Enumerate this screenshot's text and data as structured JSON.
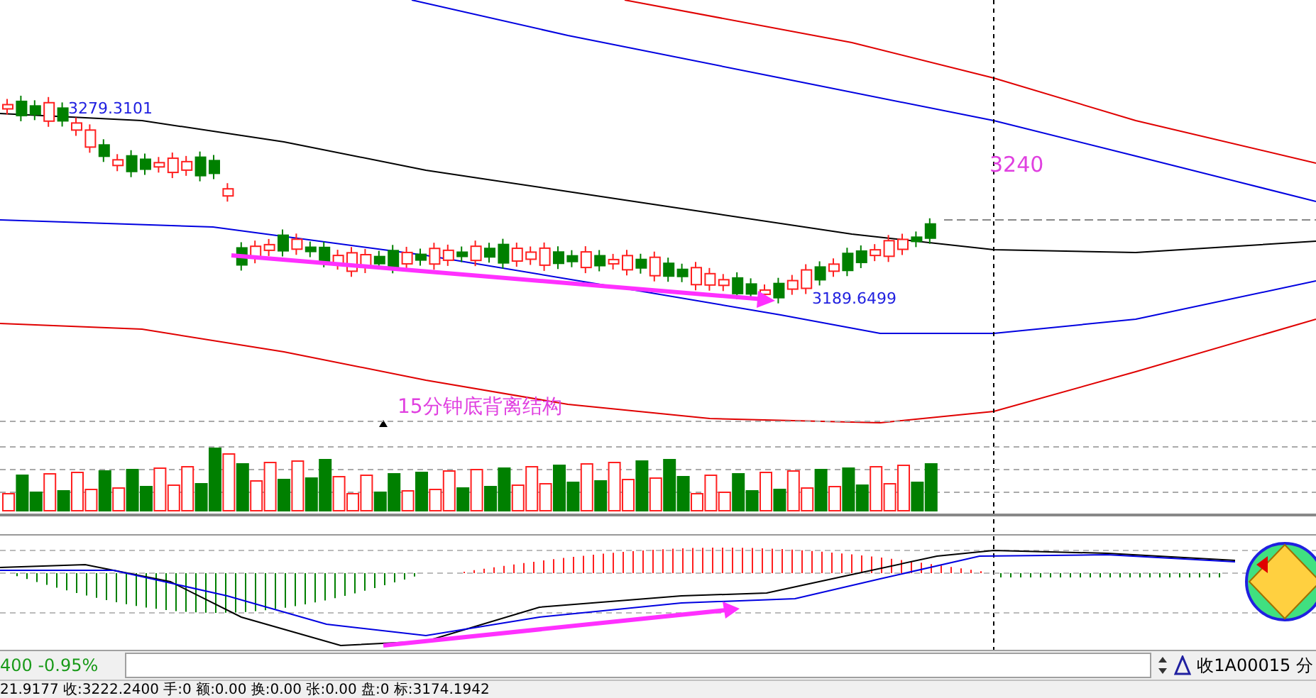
{
  "chart": {
    "price_labels": [
      {
        "kind": "high",
        "text": "3279.3101"
      },
      {
        "kind": "low",
        "text": "3189.6499"
      },
      {
        "kind": "target",
        "text": "3240"
      }
    ],
    "annotation": "15分钟底背离结构"
  },
  "quote_bar": {
    "change": "400 -0.95%",
    "code": "收1A00015 分"
  },
  "status_line": "21.9177 收:3222.2400 手:0 额:0.00 换:0.00 张:0.00 盘:0 标:3174.1942"
}
